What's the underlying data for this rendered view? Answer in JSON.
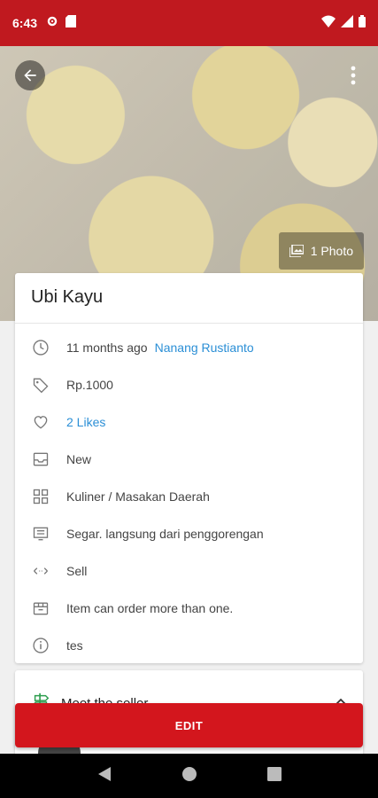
{
  "status_bar": {
    "time": "6:43"
  },
  "hero": {
    "photo_count_label": "1 Photo"
  },
  "product": {
    "title": "Ubi Kayu",
    "posted_ago": "11 months ago",
    "seller_name": "Nanang Rustianto",
    "price": "Rp.1000",
    "likes": "2 Likes",
    "condition": "New",
    "category": "Kuliner / Masakan Daerah",
    "description": "Segar. langsung dari penggorengan",
    "type": "Sell",
    "order_note": "Item can order more than one.",
    "extra_info": "tes"
  },
  "seller_section": {
    "title": "Meet the seller"
  },
  "actions": {
    "edit_label": "EDIT"
  },
  "colors": {
    "brand_red": "#c0191f",
    "link_blue": "#2b8fd6"
  }
}
